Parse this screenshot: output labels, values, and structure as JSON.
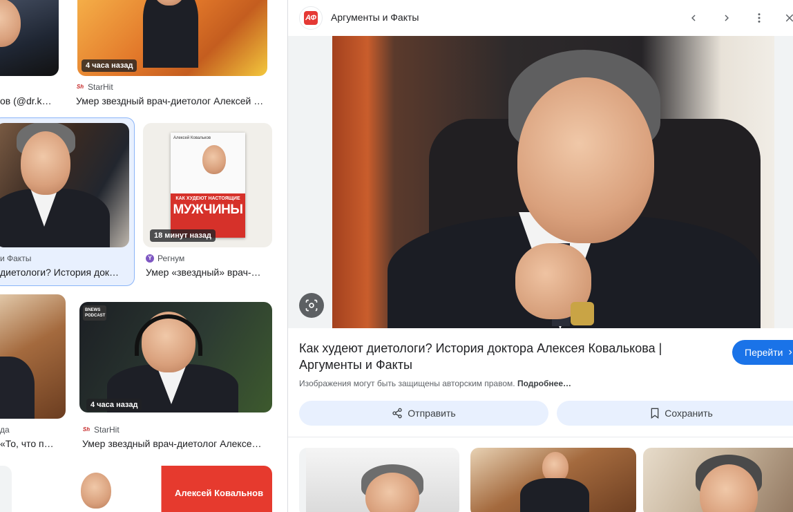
{
  "grid": {
    "row1": [
      {
        "source": "",
        "title": "ов (@dr.ko…"
      },
      {
        "time": "4 часа назад",
        "source": "StarHit",
        "title": "Умер звездный врач-диетолог Алексей …"
      }
    ],
    "row2": [
      {
        "source": "и Факты",
        "title": "диетологи? История док…"
      },
      {
        "time": "18 минут назад",
        "source": "Регнум",
        "title": "Умер «звездный» врач-…"
      }
    ],
    "row3": [
      {
        "source": "да",
        "title": "«То, что пр…"
      },
      {
        "time": "4 часа назад",
        "source": "StarHit",
        "title": "Умер звездный врач-диетолог Алексе…",
        "podcast_label": "BNEWS PODCAST"
      }
    ],
    "book": {
      "author": "Алексей Ковальков",
      "subtitle": "КАК ХУДЕЮТ НАСТОЯЩИЕ",
      "title": "МУЖЧИНЫ"
    },
    "red_banner": "Алексей Ковальнов"
  },
  "panel": {
    "site_name": "Аргументы и Факты",
    "title": "Как худеют диетологи? История доктора Алексея Ковалькова | Аргументы и Факты",
    "go_button": "Перейти",
    "copyright": "Изображения могут быть защищены авторским правом.",
    "copyright_link": "Подробнее…",
    "share_button": "Отправить",
    "save_button": "Сохранить"
  },
  "colors": {
    "accent": "#1a73e8",
    "selection": "#e8f0fe",
    "starhit": "#c62828",
    "regnum": "#7e57c2",
    "aif": "#e53935"
  }
}
